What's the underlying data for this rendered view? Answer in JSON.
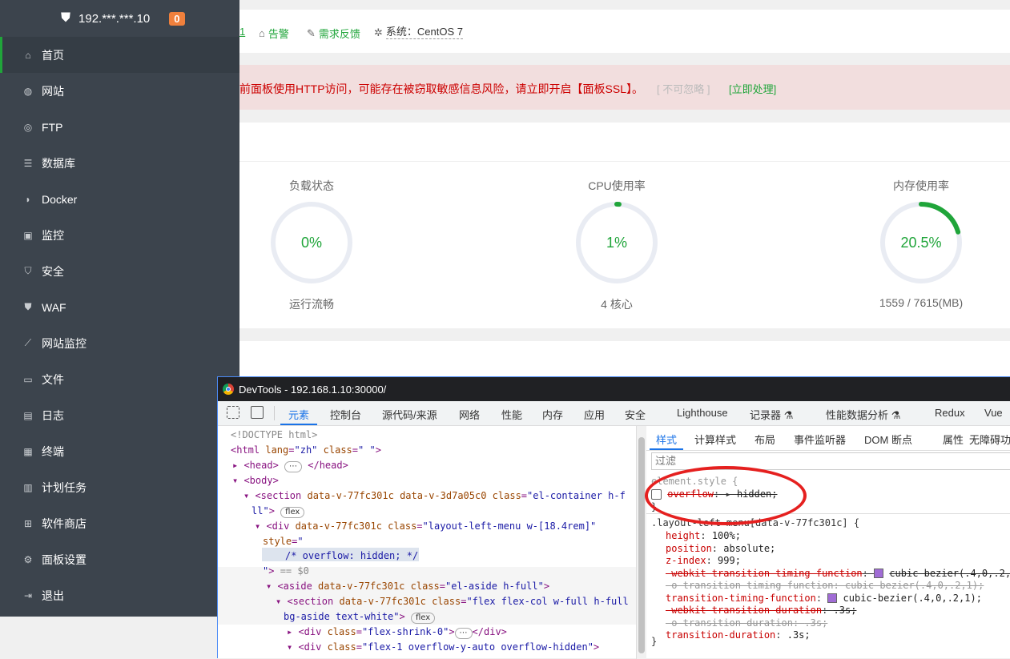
{
  "sidebar": {
    "server_ip": "192.***.***.10",
    "badge": "0",
    "items": [
      {
        "label": "首页",
        "icon": "home-icon"
      },
      {
        "label": "网站",
        "icon": "globe-icon"
      },
      {
        "label": "FTP",
        "icon": "ftp-icon"
      },
      {
        "label": "数据库",
        "icon": "database-icon"
      },
      {
        "label": "Docker",
        "icon": "docker-icon"
      },
      {
        "label": "监控",
        "icon": "monitor-icon"
      },
      {
        "label": "安全",
        "icon": "shield-icon"
      },
      {
        "label": "WAF",
        "icon": "waf-icon"
      },
      {
        "label": "网站监控",
        "icon": "chart-icon"
      },
      {
        "label": "文件",
        "icon": "folder-icon"
      },
      {
        "label": "日志",
        "icon": "log-icon"
      },
      {
        "label": "终端",
        "icon": "terminal-icon"
      },
      {
        "label": "计划任务",
        "icon": "task-icon"
      },
      {
        "label": "软件商店",
        "icon": "store-icon"
      },
      {
        "label": "面板设置",
        "icon": "settings-icon"
      },
      {
        "label": "退出",
        "icon": "logout-icon"
      }
    ]
  },
  "topbar": {
    "fragment": "1",
    "alarm": "告警",
    "feedback": "需求反馈",
    "system": "系统：CentOS 7"
  },
  "alert": {
    "text": "前面板使用HTTP访问，可能存在被窃取敏感信息风险，请立即开启【面板SSL】。",
    "ignore": "[ 不可忽略 ]",
    "action": "[立即处理]"
  },
  "gauges": [
    {
      "title": "负载状态",
      "value": "0%",
      "percent": 0,
      "sub": "运行流畅"
    },
    {
      "title": "CPU使用率",
      "value": "1%",
      "percent": 1,
      "sub": "4 核心"
    },
    {
      "title": "内存使用率",
      "value": "20.5%",
      "percent": 20.5,
      "sub": "1559 / 7615(MB)"
    }
  ],
  "devtools": {
    "title": "DevTools - 192.168.1.10:30000/",
    "tabs": [
      "元素",
      "控制台",
      "源代码/来源",
      "网络",
      "性能",
      "内存",
      "应用",
      "安全",
      "Lighthouse",
      "记录器 ⚗",
      "性能数据分析 ⚗",
      "Redux",
      "Vue"
    ],
    "style_tabs": [
      "样式",
      "计算样式",
      "布局",
      "事件监听器",
      "DOM 断点",
      "属性",
      "无障碍功"
    ],
    "filter_placeholder": "过滤",
    "pill_flex": "flex",
    "dom_lines": [
      "<!DOCTYPE html>",
      "<html lang=\"zh\" class=\" \">",
      "<head>",
      "</head>",
      "<body>",
      "<section data-v-77fc301c data-v-3d7a05c0 class=\"el-container h-f",
      "ll\">",
      "<div data-v-77fc301c class=\"layout-left-menu w-[18.4rem]\"",
      "style=\"",
      "/* overflow: hidden; */",
      "\"> == $0",
      "<aside data-v-77fc301c class=\"el-aside h-full\">",
      "<section data-v-77fc301c class=\"flex flex-col w-full h-full",
      "bg-aside text-white\">",
      "<div class=\"flex-shrink-0\">",
      "</div>",
      "<div class=\"flex-1 overflow-y-auto overflow-hidden\">"
    ],
    "css": {
      "element_style": "element.style {",
      "overflow_prop": "overflow",
      "overflow_val": "hidden;",
      "close": "}",
      "selector": ".layout-left-menu[data-v-77fc301c] {",
      "rules": [
        {
          "p": "height",
          "v": "100%;",
          "strike": false,
          "dim": false
        },
        {
          "p": "position",
          "v": "absolute;",
          "strike": false,
          "dim": false
        },
        {
          "p": "z-index",
          "v": "999;",
          "strike": false,
          "dim": false
        },
        {
          "p": "-webkit-transition-timing-function",
          "v": "cubic-bezier(.4,0,.2,",
          "strike": true,
          "dim": false,
          "swatch": true
        },
        {
          "p": "-o-transition-timing-function",
          "v": "cubic-bezier(.4,0,.2,1);",
          "strike": true,
          "dim": true
        },
        {
          "p": "transition-timing-function",
          "v": "cubic-bezier(.4,0,.2,1);",
          "strike": false,
          "dim": false,
          "swatch": true
        },
        {
          "p": "-webkit-transition-duration",
          "v": ".3s;",
          "strike": true,
          "dim": false
        },
        {
          "p": "-o-transition-duration",
          "v": ".3s;",
          "strike": true,
          "dim": true
        },
        {
          "p": "transition-duration",
          "v": ".3s;",
          "strike": false,
          "dim": false
        }
      ]
    }
  },
  "colors": {
    "accent": "#20a53a",
    "sidebar_bg": "#3c444d",
    "alert_red": "#cc0000",
    "gauge_track": "#e9ecf3",
    "annotation": "#e5201f"
  }
}
